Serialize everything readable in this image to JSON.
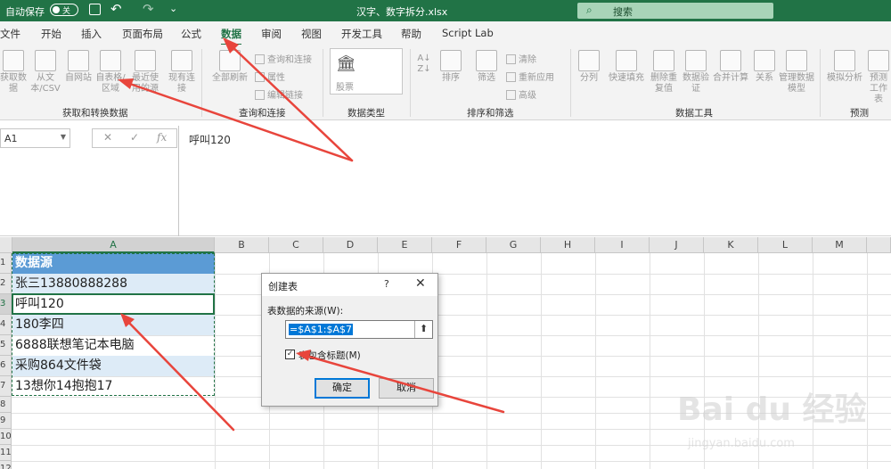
{
  "titlebar": {
    "autosave_label": "自动保存",
    "autosave_state": "关",
    "file_title": "汉字、数字拆分.xlsx",
    "search_placeholder": "搜索"
  },
  "tabs": [
    "文件",
    "开始",
    "插入",
    "页面布局",
    "公式",
    "数据",
    "审阅",
    "视图",
    "开发工具",
    "帮助",
    "Script Lab"
  ],
  "active_tab": "数据",
  "ribbon": {
    "get_data": {
      "buttons": [
        "获取数据",
        "从文本/CSV",
        "自网站",
        "自表格/区域",
        "最近使用的源",
        "现有连接"
      ],
      "label": "获取和转换数据"
    },
    "queries": {
      "refresh_all": "全部刷新",
      "items": [
        "查询和连接",
        "属性",
        "编辑链接"
      ],
      "label": "查询和连接"
    },
    "data_types": {
      "stock": "股票",
      "label": "数据类型"
    },
    "sort_filter": {
      "buttons": [
        "排序",
        "筛选"
      ],
      "items": [
        "清除",
        "重新应用",
        "高级"
      ],
      "label": "排序和筛选"
    },
    "data_tools": {
      "buttons": [
        "分列",
        "快速填充",
        "删除重复值",
        "数据验证",
        "合并计算",
        "关系",
        "管理数据模型"
      ],
      "label": "数据工具"
    },
    "forecast": {
      "buttons": [
        "模拟分析",
        "预测工作表"
      ],
      "label": "预测"
    }
  },
  "formula_bar": {
    "name_box": "A1",
    "formula": "呼叫120",
    "cancel": "✕",
    "enter": "✓",
    "fx": "fx"
  },
  "columns": [
    "A",
    "B",
    "C",
    "D",
    "E",
    "F",
    "G",
    "H",
    "I",
    "J",
    "K",
    "L",
    "M"
  ],
  "rows": [
    "1",
    "2",
    "3",
    "4",
    "5",
    "6",
    "7",
    "8",
    "9",
    "10",
    "11",
    "12"
  ],
  "cells": [
    "数据源",
    "张三13880888288",
    "呼叫120",
    "180李四",
    "6888联想笔记本电脑",
    "采购864文件袋",
    "13想你14抱抱17"
  ],
  "dialog": {
    "title": "创建表",
    "help": "?",
    "close": "✕",
    "source_label": "表数据的来源(W):",
    "range_value": "=$A$1:$A$7",
    "header_checkbox_label": "表包含标题(M)",
    "header_checked": true,
    "ok": "确定",
    "cancel": "取消"
  },
  "watermark": {
    "logo": "Bai du 经验",
    "url": "jingyan.baidu.com"
  },
  "colors": {
    "excel_green": "#217346",
    "table_header": "#5b9bd5",
    "table_band": "#ddebf7",
    "arrow": "#e8453c"
  }
}
